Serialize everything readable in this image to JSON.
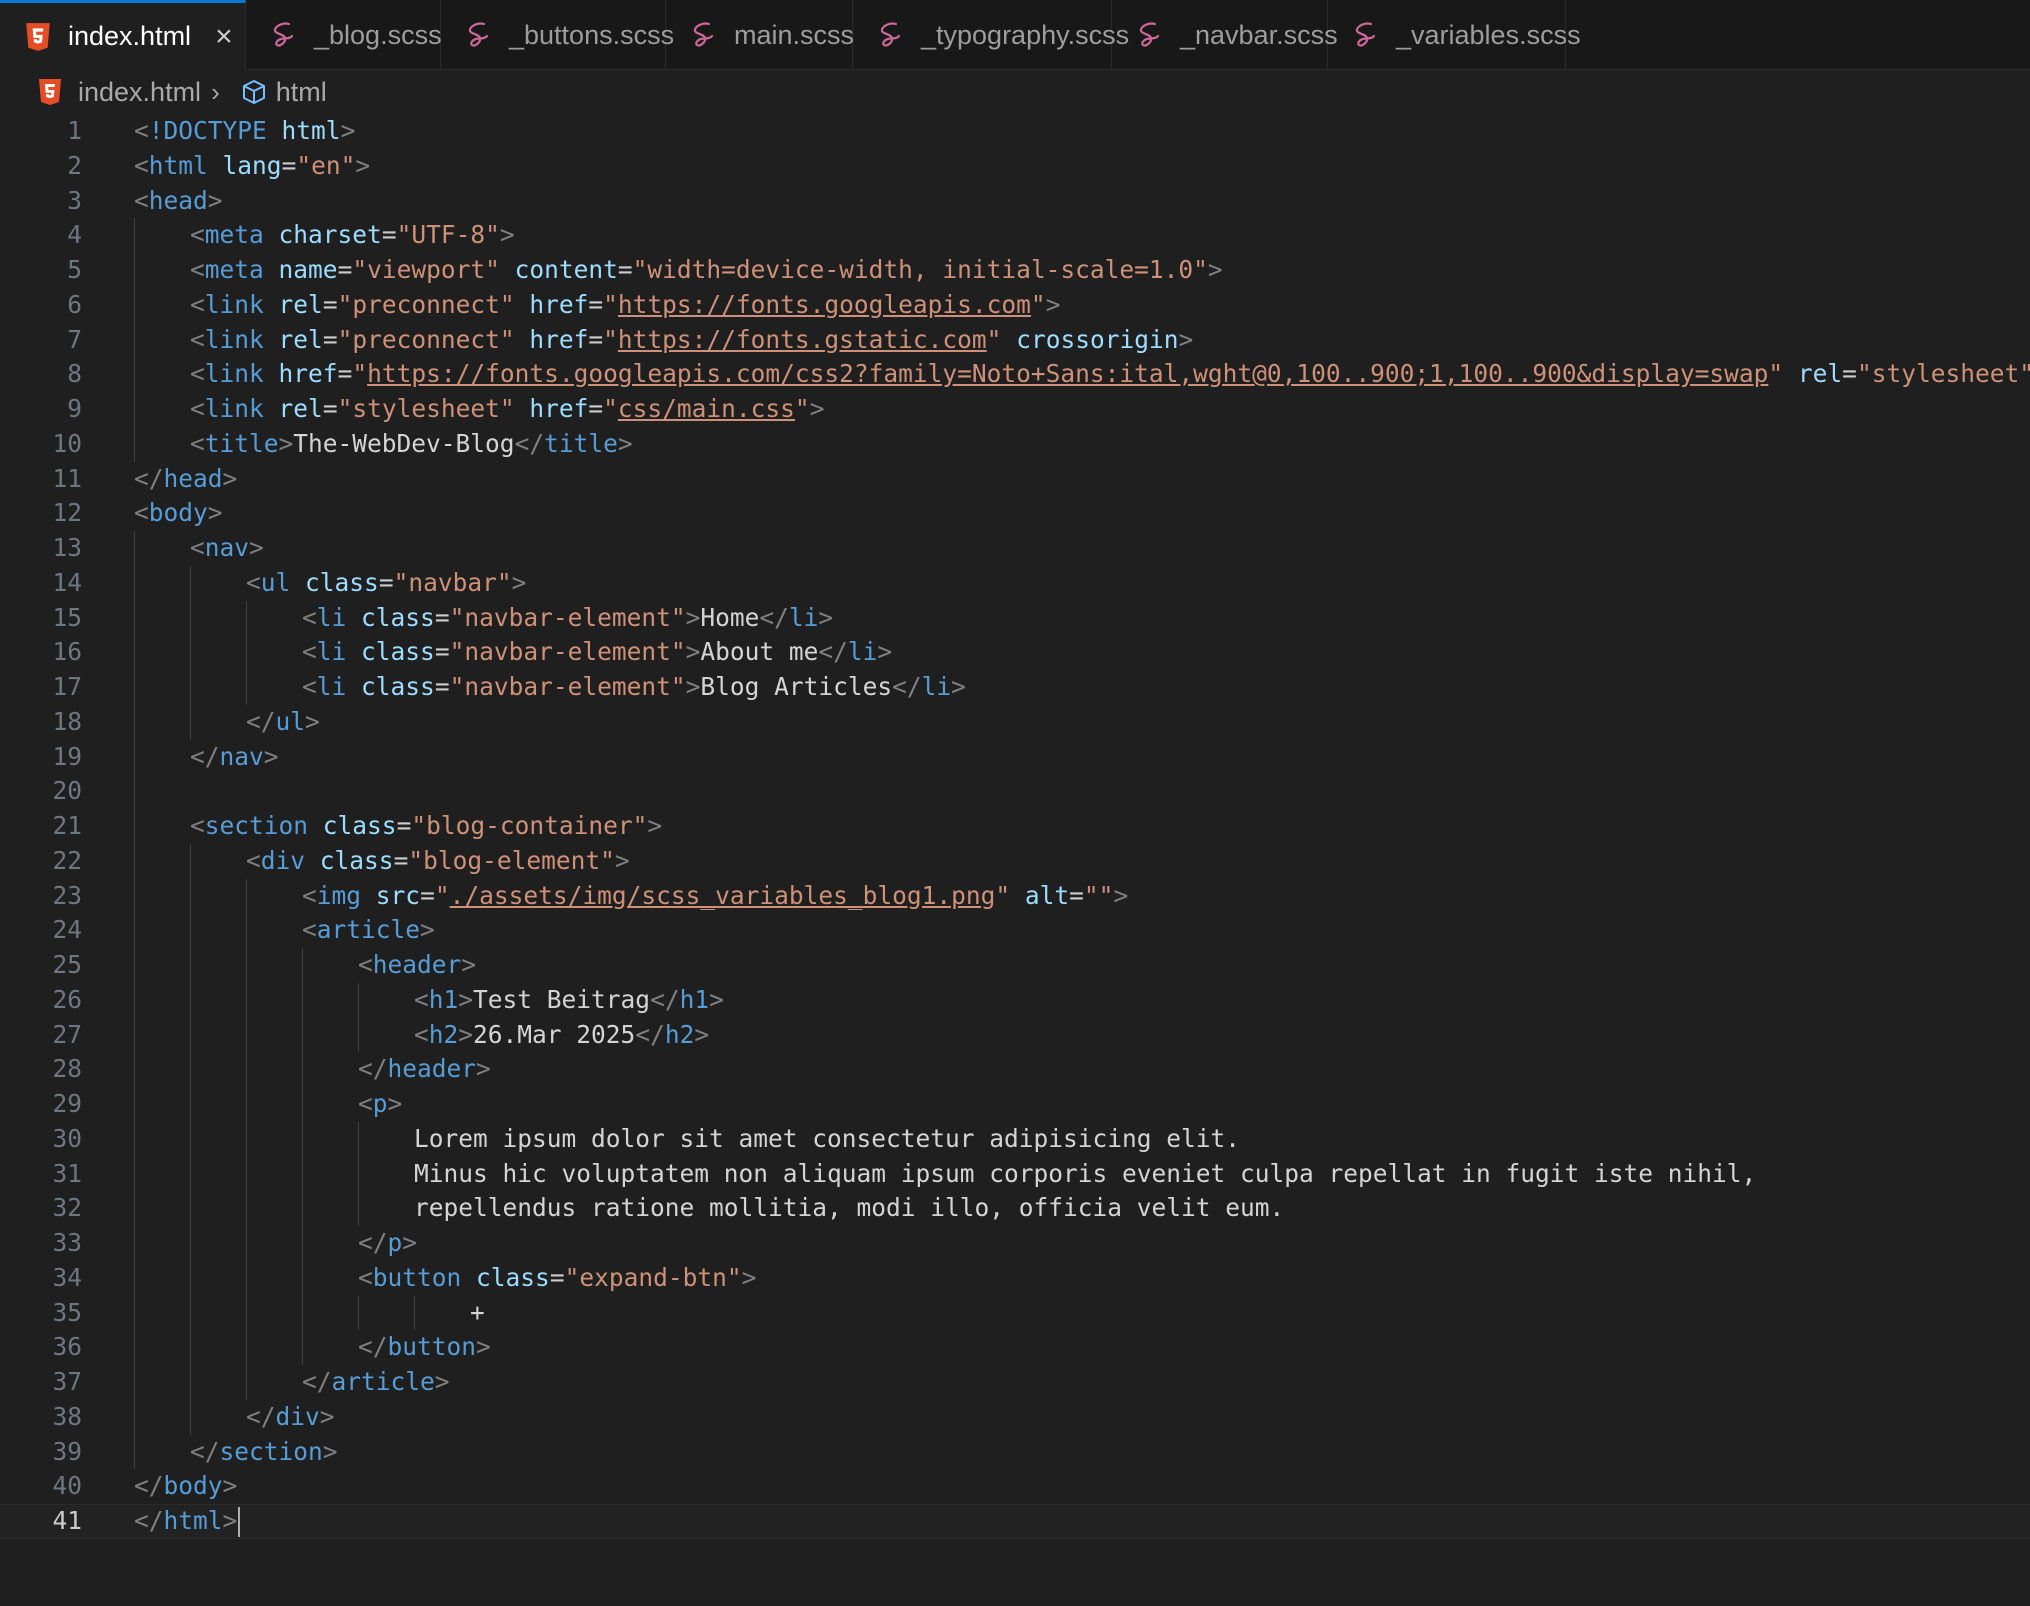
{
  "colors": {
    "html5_icon": "#e44d26",
    "scss_icon": "#cd6799",
    "accent": "#0078d4"
  },
  "tabs": [
    {
      "label": "index.html",
      "icon": "html5-icon",
      "active": true
    },
    {
      "label": "_blog.scss",
      "icon": "sass-icon"
    },
    {
      "label": "_buttons.scss",
      "icon": "sass-icon"
    },
    {
      "label": "main.scss",
      "icon": "sass-icon"
    },
    {
      "label": "_typography.scss",
      "icon": "sass-icon"
    },
    {
      "label": "_navbar.scss",
      "icon": "sass-icon"
    },
    {
      "label": "_variables.scss",
      "icon": "sass-icon"
    }
  ],
  "breadcrumb": {
    "file": "index.html",
    "symbol": "html"
  },
  "editor": {
    "current_line": 41,
    "lines": [
      {
        "n": "1",
        "tokens": [
          [
            "p",
            "<"
          ],
          [
            "d",
            "!DOCTYPE"
          ],
          [
            "e",
            " "
          ],
          [
            "a",
            "html"
          ],
          [
            "p",
            ">"
          ]
        ]
      },
      {
        "n": "2",
        "tokens": [
          [
            "p",
            "<"
          ],
          [
            "t",
            "html"
          ],
          [
            "e",
            " "
          ],
          [
            "a",
            "lang"
          ],
          [
            "e",
            "="
          ],
          [
            "s",
            "\"en\""
          ],
          [
            "p",
            ">"
          ]
        ]
      },
      {
        "n": "3",
        "tokens": [
          [
            "p",
            "<"
          ],
          [
            "t",
            "head"
          ],
          [
            "p",
            ">"
          ]
        ]
      },
      {
        "n": "4",
        "indent": 1,
        "tokens": [
          [
            "p",
            "<"
          ],
          [
            "t",
            "meta"
          ],
          [
            "e",
            " "
          ],
          [
            "a",
            "charset"
          ],
          [
            "e",
            "="
          ],
          [
            "s",
            "\"UTF-8\""
          ],
          [
            "p",
            ">"
          ]
        ]
      },
      {
        "n": "5",
        "indent": 1,
        "tokens": [
          [
            "p",
            "<"
          ],
          [
            "t",
            "meta"
          ],
          [
            "e",
            " "
          ],
          [
            "a",
            "name"
          ],
          [
            "e",
            "="
          ],
          [
            "s",
            "\"viewport\""
          ],
          [
            "e",
            " "
          ],
          [
            "a",
            "content"
          ],
          [
            "e",
            "="
          ],
          [
            "s",
            "\"width=device-width, initial-scale=1.0\""
          ],
          [
            "p",
            ">"
          ]
        ]
      },
      {
        "n": "6",
        "indent": 1,
        "tokens": [
          [
            "p",
            "<"
          ],
          [
            "t",
            "link"
          ],
          [
            "e",
            " "
          ],
          [
            "a",
            "rel"
          ],
          [
            "e",
            "="
          ],
          [
            "s",
            "\"preconnect\""
          ],
          [
            "e",
            " "
          ],
          [
            "a",
            "href"
          ],
          [
            "e",
            "="
          ],
          [
            "s",
            "\""
          ],
          [
            "u",
            "https://fonts.googleapis.com"
          ],
          [
            "s",
            "\""
          ],
          [
            "p",
            ">"
          ]
        ]
      },
      {
        "n": "7",
        "indent": 1,
        "tokens": [
          [
            "p",
            "<"
          ],
          [
            "t",
            "link"
          ],
          [
            "e",
            " "
          ],
          [
            "a",
            "rel"
          ],
          [
            "e",
            "="
          ],
          [
            "s",
            "\"preconnect\""
          ],
          [
            "e",
            " "
          ],
          [
            "a",
            "href"
          ],
          [
            "e",
            "="
          ],
          [
            "s",
            "\""
          ],
          [
            "u",
            "https://fonts.gstatic.com"
          ],
          [
            "s",
            "\""
          ],
          [
            "e",
            " "
          ],
          [
            "a",
            "crossorigin"
          ],
          [
            "p",
            ">"
          ]
        ]
      },
      {
        "n": "8",
        "indent": 1,
        "tokens": [
          [
            "p",
            "<"
          ],
          [
            "t",
            "link"
          ],
          [
            "e",
            " "
          ],
          [
            "a",
            "href"
          ],
          [
            "e",
            "="
          ],
          [
            "s",
            "\""
          ],
          [
            "u",
            "https://fonts.googleapis.com/css2?family=Noto+Sans:ital,wght@0,100..900;1,100..900&display=swap"
          ],
          [
            "s",
            "\""
          ],
          [
            "e",
            " "
          ],
          [
            "a",
            "rel"
          ],
          [
            "e",
            "="
          ],
          [
            "s",
            "\"stylesheet\""
          ],
          [
            "p",
            ">"
          ]
        ]
      },
      {
        "n": "9",
        "indent": 1,
        "tokens": [
          [
            "p",
            "<"
          ],
          [
            "t",
            "link"
          ],
          [
            "e",
            " "
          ],
          [
            "a",
            "rel"
          ],
          [
            "e",
            "="
          ],
          [
            "s",
            "\"stylesheet\""
          ],
          [
            "e",
            " "
          ],
          [
            "a",
            "href"
          ],
          [
            "e",
            "="
          ],
          [
            "s",
            "\""
          ],
          [
            "u",
            "css/main.css"
          ],
          [
            "s",
            "\""
          ],
          [
            "p",
            ">"
          ]
        ]
      },
      {
        "n": "10",
        "indent": 1,
        "tokens": [
          [
            "p",
            "<"
          ],
          [
            "t",
            "title"
          ],
          [
            "p",
            ">"
          ],
          [
            "x",
            "The-WebDev-Blog"
          ],
          [
            "p",
            "</"
          ],
          [
            "t",
            "title"
          ],
          [
            "p",
            ">"
          ]
        ]
      },
      {
        "n": "11",
        "tokens": [
          [
            "p",
            "</"
          ],
          [
            "t",
            "head"
          ],
          [
            "p",
            ">"
          ]
        ]
      },
      {
        "n": "12",
        "tokens": [
          [
            "p",
            "<"
          ],
          [
            "t",
            "body"
          ],
          [
            "p",
            ">"
          ]
        ]
      },
      {
        "n": "13",
        "indent": 1,
        "tokens": [
          [
            "p",
            "<"
          ],
          [
            "t",
            "nav"
          ],
          [
            "p",
            ">"
          ]
        ]
      },
      {
        "n": "14",
        "indent": 2,
        "tokens": [
          [
            "p",
            "<"
          ],
          [
            "t",
            "ul"
          ],
          [
            "e",
            " "
          ],
          [
            "a",
            "class"
          ],
          [
            "e",
            "="
          ],
          [
            "s",
            "\"navbar\""
          ],
          [
            "p",
            ">"
          ]
        ]
      },
      {
        "n": "15",
        "indent": 3,
        "tokens": [
          [
            "p",
            "<"
          ],
          [
            "t",
            "li"
          ],
          [
            "e",
            " "
          ],
          [
            "a",
            "class"
          ],
          [
            "e",
            "="
          ],
          [
            "s",
            "\"navbar-element\""
          ],
          [
            "p",
            ">"
          ],
          [
            "x",
            "Home"
          ],
          [
            "p",
            "</"
          ],
          [
            "t",
            "li"
          ],
          [
            "p",
            ">"
          ]
        ]
      },
      {
        "n": "16",
        "indent": 3,
        "tokens": [
          [
            "p",
            "<"
          ],
          [
            "t",
            "li"
          ],
          [
            "e",
            " "
          ],
          [
            "a",
            "class"
          ],
          [
            "e",
            "="
          ],
          [
            "s",
            "\"navbar-element\""
          ],
          [
            "p",
            ">"
          ],
          [
            "x",
            "About me"
          ],
          [
            "p",
            "</"
          ],
          [
            "t",
            "li"
          ],
          [
            "p",
            ">"
          ]
        ]
      },
      {
        "n": "17",
        "indent": 3,
        "tokens": [
          [
            "p",
            "<"
          ],
          [
            "t",
            "li"
          ],
          [
            "e",
            " "
          ],
          [
            "a",
            "class"
          ],
          [
            "e",
            "="
          ],
          [
            "s",
            "\"navbar-element\""
          ],
          [
            "p",
            ">"
          ],
          [
            "x",
            "Blog Articles"
          ],
          [
            "p",
            "</"
          ],
          [
            "t",
            "li"
          ],
          [
            "p",
            ">"
          ]
        ]
      },
      {
        "n": "18",
        "indent": 2,
        "tokens": [
          [
            "p",
            "</"
          ],
          [
            "t",
            "ul"
          ],
          [
            "p",
            ">"
          ]
        ]
      },
      {
        "n": "19",
        "indent": 1,
        "tokens": [
          [
            "p",
            "</"
          ],
          [
            "t",
            "nav"
          ],
          [
            "p",
            ">"
          ]
        ]
      },
      {
        "n": "20",
        "tokens": []
      },
      {
        "n": "21",
        "indent": 1,
        "tokens": [
          [
            "p",
            "<"
          ],
          [
            "t",
            "section"
          ],
          [
            "e",
            " "
          ],
          [
            "a",
            "class"
          ],
          [
            "e",
            "="
          ],
          [
            "s",
            "\"blog-container\""
          ],
          [
            "p",
            ">"
          ]
        ]
      },
      {
        "n": "22",
        "indent": 2,
        "tokens": [
          [
            "p",
            "<"
          ],
          [
            "t",
            "div"
          ],
          [
            "e",
            " "
          ],
          [
            "a",
            "class"
          ],
          [
            "e",
            "="
          ],
          [
            "s",
            "\"blog-element\""
          ],
          [
            "p",
            ">"
          ]
        ]
      },
      {
        "n": "23",
        "indent": 3,
        "tokens": [
          [
            "p",
            "<"
          ],
          [
            "t",
            "img"
          ],
          [
            "e",
            " "
          ],
          [
            "a",
            "src"
          ],
          [
            "e",
            "="
          ],
          [
            "s",
            "\""
          ],
          [
            "u",
            "./assets/img/scss_variables_blog1.png"
          ],
          [
            "s",
            "\""
          ],
          [
            "e",
            " "
          ],
          [
            "a",
            "alt"
          ],
          [
            "e",
            "="
          ],
          [
            "s",
            "\"\""
          ],
          [
            "p",
            ">"
          ]
        ]
      },
      {
        "n": "24",
        "indent": 3,
        "tokens": [
          [
            "p",
            "<"
          ],
          [
            "t",
            "article"
          ],
          [
            "p",
            ">"
          ]
        ]
      },
      {
        "n": "25",
        "indent": 4,
        "tokens": [
          [
            "p",
            "<"
          ],
          [
            "t",
            "header"
          ],
          [
            "p",
            ">"
          ]
        ]
      },
      {
        "n": "26",
        "indent": 5,
        "tokens": [
          [
            "p",
            "<"
          ],
          [
            "t",
            "h1"
          ],
          [
            "p",
            ">"
          ],
          [
            "x",
            "Test Beitrag"
          ],
          [
            "p",
            "</"
          ],
          [
            "t",
            "h1"
          ],
          [
            "p",
            ">"
          ]
        ]
      },
      {
        "n": "27",
        "indent": 5,
        "tokens": [
          [
            "p",
            "<"
          ],
          [
            "t",
            "h2"
          ],
          [
            "p",
            ">"
          ],
          [
            "x",
            "26.Mar 2025"
          ],
          [
            "p",
            "</"
          ],
          [
            "t",
            "h2"
          ],
          [
            "p",
            ">"
          ]
        ]
      },
      {
        "n": "28",
        "indent": 4,
        "tokens": [
          [
            "p",
            "</"
          ],
          [
            "t",
            "header"
          ],
          [
            "p",
            ">"
          ]
        ]
      },
      {
        "n": "29",
        "indent": 4,
        "tokens": [
          [
            "p",
            "<"
          ],
          [
            "t",
            "p"
          ],
          [
            "p",
            ">"
          ]
        ]
      },
      {
        "n": "30",
        "indent": 5,
        "tokens": [
          [
            "x",
            "Lorem ipsum dolor sit amet consectetur adipisicing elit."
          ]
        ]
      },
      {
        "n": "31",
        "indent": 5,
        "tokens": [
          [
            "x",
            "Minus hic voluptatem non aliquam ipsum corporis eveniet culpa repellat in fugit iste nihil,"
          ]
        ]
      },
      {
        "n": "32",
        "indent": 5,
        "tokens": [
          [
            "x",
            "repellendus ratione mollitia, modi illo, officia velit eum."
          ]
        ]
      },
      {
        "n": "33",
        "indent": 4,
        "tokens": [
          [
            "p",
            "</"
          ],
          [
            "t",
            "p"
          ],
          [
            "p",
            ">"
          ]
        ]
      },
      {
        "n": "34",
        "indent": 4,
        "tokens": [
          [
            "p",
            "<"
          ],
          [
            "t",
            "button"
          ],
          [
            "e",
            " "
          ],
          [
            "a",
            "class"
          ],
          [
            "e",
            "="
          ],
          [
            "s",
            "\"expand-btn\""
          ],
          [
            "p",
            ">"
          ]
        ]
      },
      {
        "n": "35",
        "indent": 6,
        "tokens": [
          [
            "x",
            "+"
          ]
        ]
      },
      {
        "n": "36",
        "indent": 4,
        "tokens": [
          [
            "p",
            "</"
          ],
          [
            "t",
            "button"
          ],
          [
            "p",
            ">"
          ]
        ]
      },
      {
        "n": "37",
        "indent": 3,
        "tokens": [
          [
            "p",
            "</"
          ],
          [
            "t",
            "article"
          ],
          [
            "p",
            ">"
          ]
        ]
      },
      {
        "n": "38",
        "indent": 2,
        "tokens": [
          [
            "p",
            "</"
          ],
          [
            "t",
            "div"
          ],
          [
            "p",
            ">"
          ]
        ]
      },
      {
        "n": "39",
        "indent": 1,
        "tokens": [
          [
            "p",
            "</"
          ],
          [
            "t",
            "section"
          ],
          [
            "p",
            ">"
          ]
        ]
      },
      {
        "n": "40",
        "tokens": [
          [
            "p",
            "</"
          ],
          [
            "t",
            "body"
          ],
          [
            "p",
            ">"
          ]
        ]
      },
      {
        "n": "41",
        "tokens": [
          [
            "p",
            "</"
          ],
          [
            "t",
            "html"
          ],
          [
            "p",
            ">"
          ]
        ]
      }
    ]
  }
}
